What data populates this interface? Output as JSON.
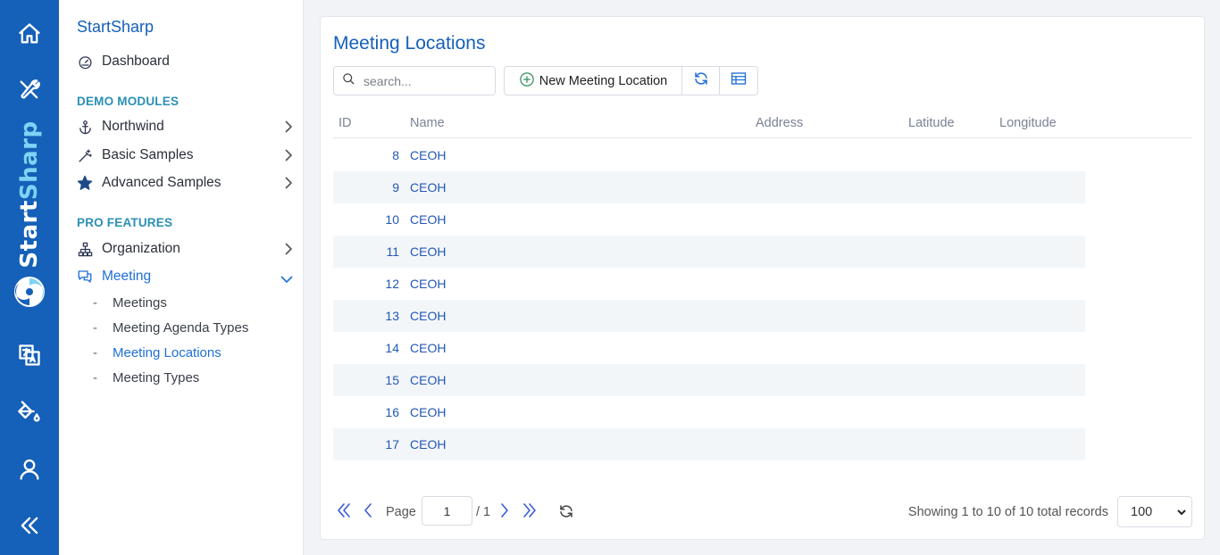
{
  "rail": {
    "brand_dark": "Start",
    "brand_light": "Sharp",
    "icons": [
      "home-icon",
      "tools-icon",
      "translate-icon",
      "paint-bucket-icon",
      "user-icon",
      "collapse-icon"
    ]
  },
  "sidebar": {
    "title": "StartSharp",
    "dashboard": "Dashboard",
    "section_demo": "DEMO MODULES",
    "northwind": "Northwind",
    "basic_samples": "Basic Samples",
    "advanced_samples": "Advanced Samples",
    "section_pro": "PRO FEATURES",
    "organization": "Organization",
    "meeting": "Meeting",
    "sub_items": [
      {
        "label": "Meetings"
      },
      {
        "label": "Meeting Agenda Types"
      },
      {
        "label": "Meeting Locations"
      },
      {
        "label": "Meeting Types"
      }
    ],
    "dash": "-"
  },
  "main": {
    "title": "Meeting Locations",
    "search_placeholder": "search...",
    "new_button": "New Meeting Location",
    "columns": {
      "id": "ID",
      "name": "Name",
      "address": "Address",
      "latitude": "Latitude",
      "longitude": "Longitude"
    },
    "rows": [
      {
        "id": "8",
        "name": "CEOH"
      },
      {
        "id": "9",
        "name": "CEOH"
      },
      {
        "id": "10",
        "name": "CEOH"
      },
      {
        "id": "11",
        "name": "CEOH"
      },
      {
        "id": "12",
        "name": "CEOH"
      },
      {
        "id": "13",
        "name": "CEOH"
      },
      {
        "id": "14",
        "name": "CEOH"
      },
      {
        "id": "15",
        "name": "CEOH"
      },
      {
        "id": "16",
        "name": "CEOH"
      },
      {
        "id": "17",
        "name": "CEOH"
      }
    ]
  },
  "pager": {
    "page_label": "Page",
    "page_value": "1",
    "of_label": "/ 1",
    "info": "Showing 1 to 10 of 10 total records",
    "page_size": "100"
  },
  "colors": {
    "rail": "#1560b8",
    "accent": "#1f6fd6",
    "section": "#2b8fb5",
    "link": "#2257b5"
  }
}
